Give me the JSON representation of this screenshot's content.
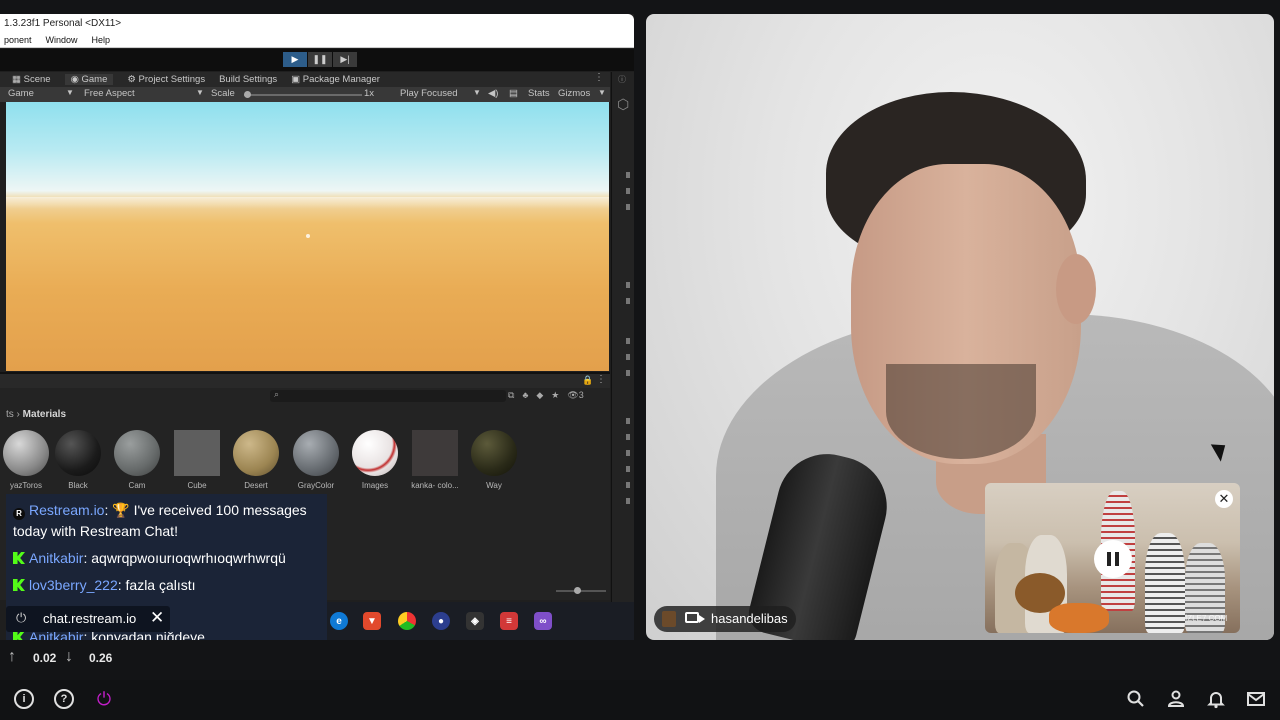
{
  "share": {
    "title": "1.3.23f1 Personal <DX11>",
    "menu": [
      "ponent",
      "Window",
      "Help"
    ],
    "tabs": [
      "Scene",
      "Game",
      "Project Settings",
      "Build Settings",
      "Package Manager"
    ],
    "game_bar": {
      "display": "Game",
      "aspect": "Free Aspect",
      "scale_label": "Scale",
      "scale_value": "1x",
      "play_mode": "Play Focused",
      "stats": "Stats",
      "gizmos": "Gizmos"
    },
    "project": {
      "breadcrumb_prefix": "ts",
      "breadcrumb_current": "Materials",
      "materials": [
        "yazToros",
        "Black",
        "Cam",
        "Cube",
        "Desert",
        "GrayColor",
        "Images",
        "kanka- colo...",
        "Way"
      ],
      "count": "3"
    }
  },
  "chat": {
    "messages": [
      {
        "user": "Restream.io",
        "badge": "restream",
        "text": "🏆 I've received 100 messages today with Restream Chat!"
      },
      {
        "user": "Anitkabir",
        "badge": "kick",
        "text": "aqwrqpwoıurıoqwrhıoqwrhwrqü"
      },
      {
        "user": "lov3berry_222",
        "badge": "kick",
        "text": "fazla çalıstı"
      },
      {
        "user": "Anitkabir",
        "badge": "kick",
        "text": "konyadan ni̇ğdeye"
      }
    ],
    "source_label": "chat.restream.io"
  },
  "camera": {
    "name": "hasandelibas"
  },
  "pip": {
    "watermark": "İZLE7 COM"
  },
  "stats": {
    "up": "0.02",
    "down": "0.26"
  },
  "icons": {
    "left": [
      "info-icon",
      "help-icon",
      "power-icon"
    ],
    "right": [
      "search-icon",
      "profile-icon",
      "notifications-icon",
      "mail-icon"
    ]
  }
}
